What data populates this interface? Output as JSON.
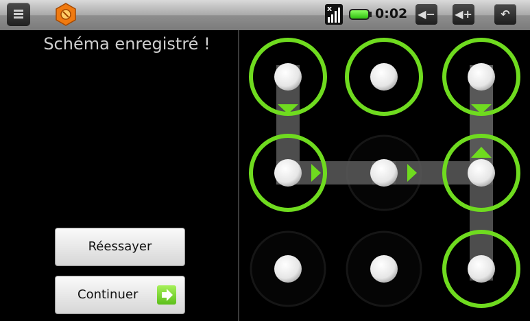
{
  "status_bar": {
    "time": "0:02",
    "signal_mark": "x",
    "vol_down_label": "◀−",
    "vol_up_label": "◀+",
    "back_label": "↶",
    "battery_color": "#46d01e"
  },
  "title": "Schéma enregistré !",
  "buttons": {
    "retry": "Réessayer",
    "continue": "Continuer"
  },
  "pattern": {
    "accent_color": "#6fdb1f",
    "grid_size": 3,
    "sequence": [
      [
        0,
        0
      ],
      [
        0,
        1
      ],
      [
        1,
        1
      ],
      [
        2,
        1
      ],
      [
        2,
        0
      ],
      [
        2,
        2
      ]
    ],
    "selected": [
      [
        0,
        0
      ],
      [
        1,
        0
      ],
      [
        2,
        0
      ],
      [
        0,
        1
      ],
      [
        2,
        1
      ],
      [
        2,
        2
      ]
    ]
  }
}
